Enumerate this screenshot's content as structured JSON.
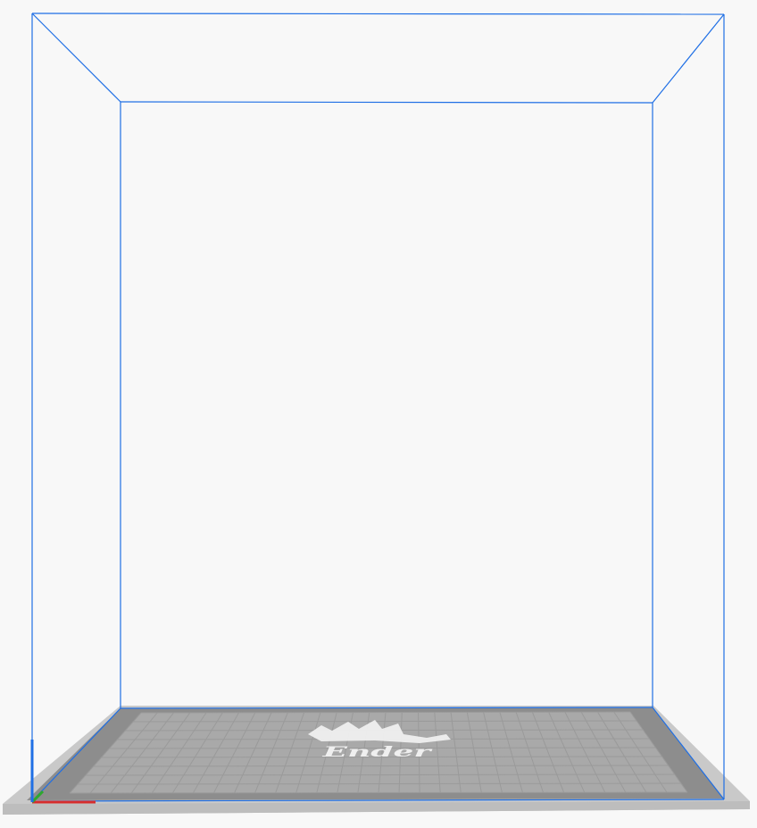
{
  "viewport": {
    "background": "#f8f8f8",
    "volume_edge_color": "#1f6fe5",
    "bed_logo_text": "Ender",
    "bed_logo_icon": "crown-icon"
  },
  "colors": {
    "bed_surround": "#c9c9c9",
    "bed_rim": "#b6b6b6",
    "bed_border": "#8d8d8d",
    "bed_plate": "#a8a8a8",
    "bed_grid": "#999999",
    "logo": "#efefef",
    "axis_x": "#d62d2d",
    "axis_y": "#2da82d",
    "axis_z": "#1f6fe5"
  }
}
